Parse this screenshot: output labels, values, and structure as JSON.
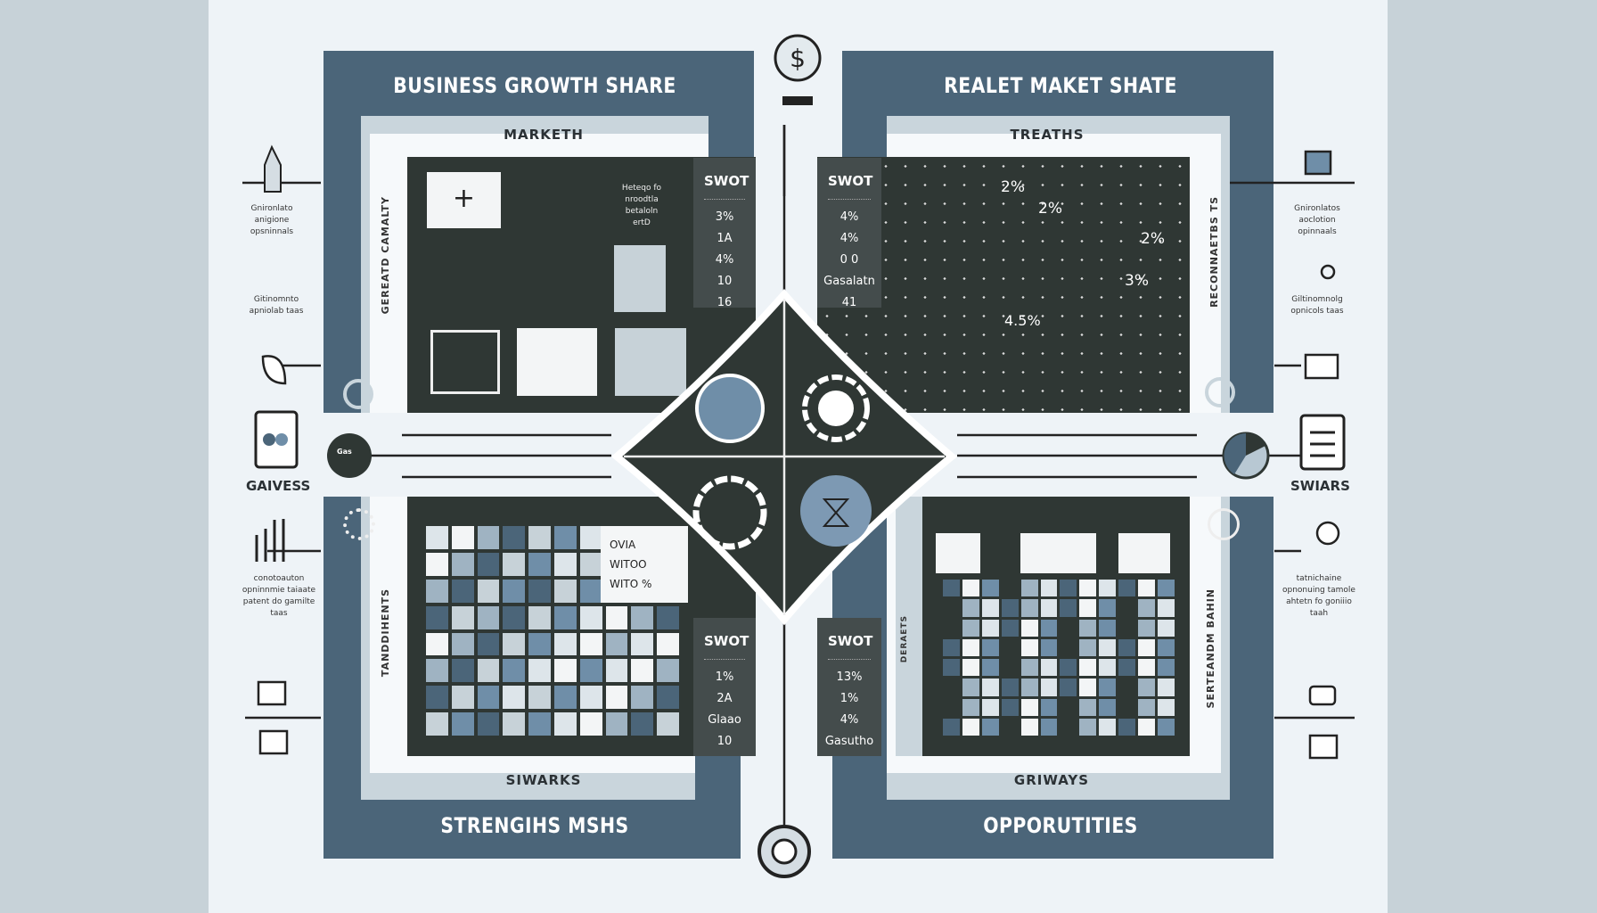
{
  "panels": {
    "top_left": {
      "title": "BUSINESS GROWTH  SHARE",
      "subtitle": "MARKETH",
      "side_label": "GEREATD CAMALTY",
      "note": [
        "Heteqo fo",
        "nroodtla",
        "betaloln",
        "ertD"
      ],
      "swot": {
        "heading": "SWOT",
        "values": [
          "3%",
          "1A",
          "4%",
          "10",
          "16"
        ]
      }
    },
    "top_right": {
      "title": "REALET MAKET SHATE",
      "subtitle": "TREATHS",
      "side_label": "RECONNAETBS TS",
      "swot": {
        "heading": "SWOT",
        "values": [
          "4%",
          "4%",
          "0 0",
          "Gasalatn",
          "41"
        ]
      },
      "chart_labels": [
        "2%",
        "2%",
        "2%",
        "3%",
        "4.5%"
      ]
    },
    "bottom_left": {
      "title": "STRENGIHS MSHS",
      "subtitle": "SIWARKS",
      "side_label": "TANDDIHENTS",
      "legend": [
        "OVIA",
        "WITOO",
        "WITO %"
      ],
      "swot": {
        "heading": "SWOT",
        "values": [
          "1%",
          "2A",
          "Glaao",
          "10"
        ]
      }
    },
    "bottom_right": {
      "title": "OPPORUTITIES",
      "subtitle": "GRIWAYS",
      "side_label": "SERTEANDM BAHIN",
      "side_label_2": "DERAETS",
      "swot": {
        "heading": "SWOT",
        "values": [
          "13%",
          "1%",
          "4%",
          "Gasutho"
        ]
      }
    }
  },
  "side": {
    "left_label": "GAIVESS",
    "left_circle_text": "Gas",
    "right_label": "SWIARS",
    "left_notes": [
      "Gnironlato anigione opsninnals",
      "Gitinomnto apniolab taas",
      "conotoauton opninnmie taiaate patent do gamilte taas"
    ],
    "right_notes": [
      "Gnironlatos aoclotion opinnaals",
      "Giltinomnolg opnicols taas",
      "tatnichaine opnonuing tamole ahtetn fo goniiio taah"
    ]
  },
  "colors": {
    "frame": "#4b6579",
    "board": "#2f3734",
    "accent": "#6f8ea8",
    "background": "#eef3f7"
  },
  "icons": [
    "dollar-pin-icon",
    "pencil-icon",
    "flask-icon",
    "leaf-icon",
    "document-icon",
    "bar-chart-icon",
    "box-icon",
    "envelope-icon",
    "easel-icon",
    "key-icon",
    "presentation-icon",
    "clipboard-icon",
    "lightbulb-icon",
    "briefcase-icon",
    "globe-icon",
    "gear-icon",
    "compass-icon"
  ]
}
